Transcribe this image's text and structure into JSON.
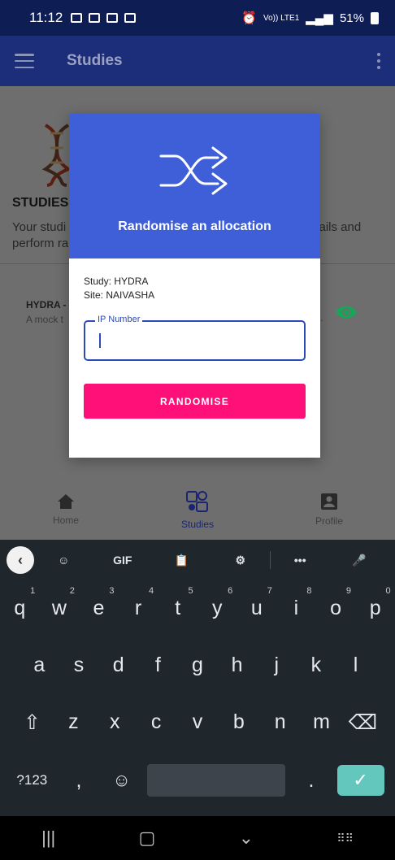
{
  "status_bar": {
    "time": "11:12",
    "network": "Vo)) LTE1",
    "battery": "51%"
  },
  "app_bar": {
    "title": "Studies"
  },
  "background_content": {
    "heading": "STUDIES",
    "description_left": "Your studi",
    "description_left_line2": "perform ra",
    "description_right": "etails and",
    "study_item_title": "HYDRA -",
    "study_item_sub": "A mock t",
    "study_item_trail": "."
  },
  "bottom_nav": {
    "items": [
      {
        "label": "Home",
        "icon": "home-icon"
      },
      {
        "label": "Studies",
        "icon": "studies-icon"
      },
      {
        "label": "Profile",
        "icon": "profile-icon"
      }
    ]
  },
  "dialog": {
    "title": "Randomise an allocation",
    "study": "Study: HYDRA",
    "site": "Site: NAIVASHA",
    "field_label": "IP Number",
    "field_value": "",
    "button_label": "RANDOMISE"
  },
  "keyboard": {
    "toolbar": [
      "GIF",
      "•••"
    ],
    "row1": [
      {
        "k": "q",
        "n": "1"
      },
      {
        "k": "w",
        "n": "2"
      },
      {
        "k": "e",
        "n": "3"
      },
      {
        "k": "r",
        "n": "4"
      },
      {
        "k": "t",
        "n": "5"
      },
      {
        "k": "y",
        "n": "6"
      },
      {
        "k": "u",
        "n": "7"
      },
      {
        "k": "i",
        "n": "8"
      },
      {
        "k": "o",
        "n": "9"
      },
      {
        "k": "p",
        "n": "0"
      }
    ],
    "row2": [
      "a",
      "s",
      "d",
      "f",
      "g",
      "h",
      "j",
      "k",
      "l"
    ],
    "row3": [
      "z",
      "x",
      "c",
      "v",
      "b",
      "n",
      "m"
    ],
    "row4": {
      "symbols": "?123",
      "comma": ",",
      "period": "."
    }
  },
  "colors": {
    "dialog_header": "#3e5fd8",
    "button": "#ff0f78",
    "accent": "#2c4bb8",
    "eye": "#17a558"
  }
}
